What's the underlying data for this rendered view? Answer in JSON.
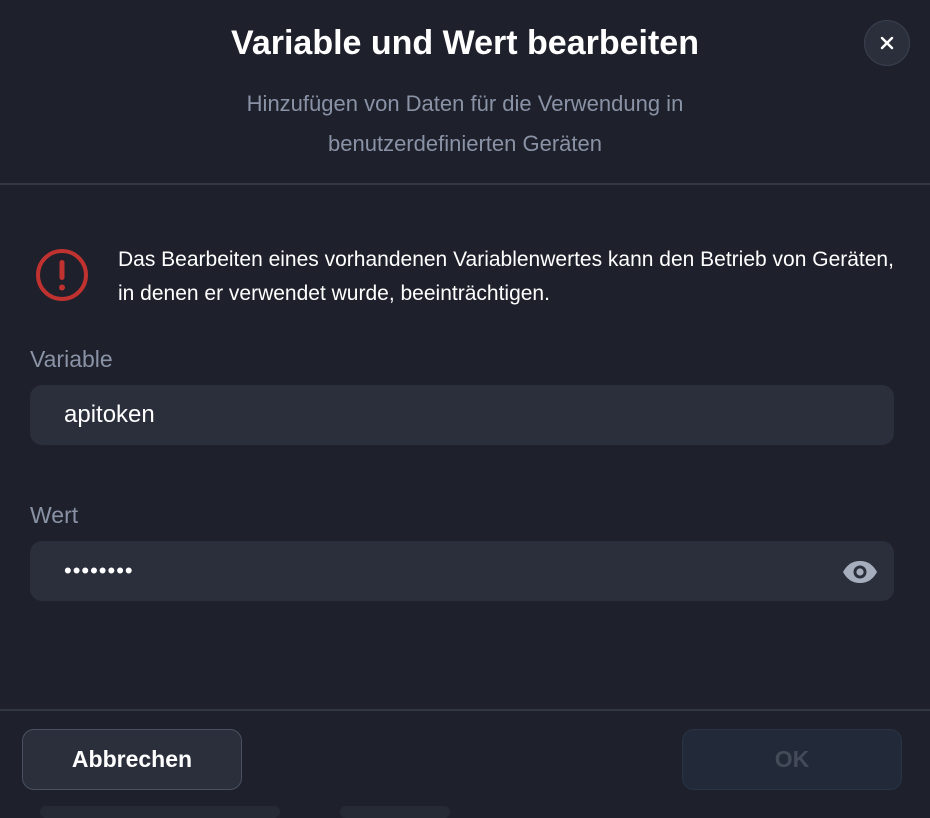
{
  "dialog": {
    "title": "Variable und Wert bearbeiten",
    "subtitle": "Hinzufügen von Daten für die Verwendung in benutzerdefinierten Geräten",
    "close_icon": "close-icon"
  },
  "warning": {
    "icon": "warning-circle-icon",
    "text": "Das Bearbeiten eines vorhandenen Variablenwertes kann den Betrieb von Geräten, in denen er verwendet wurde, beeinträchtigen."
  },
  "fields": {
    "variable": {
      "label": "Variable",
      "value": "apitoken"
    },
    "value": {
      "label": "Wert",
      "value": "••••••••",
      "toggle_icon": "eye-icon"
    }
  },
  "footer": {
    "cancel_label": "Abbrechen",
    "ok_label": "OK"
  },
  "colors": {
    "background": "#1e212b",
    "input_background": "#2b2f3b",
    "warning_red": "#c0322f",
    "muted_text": "#8a92a6"
  }
}
